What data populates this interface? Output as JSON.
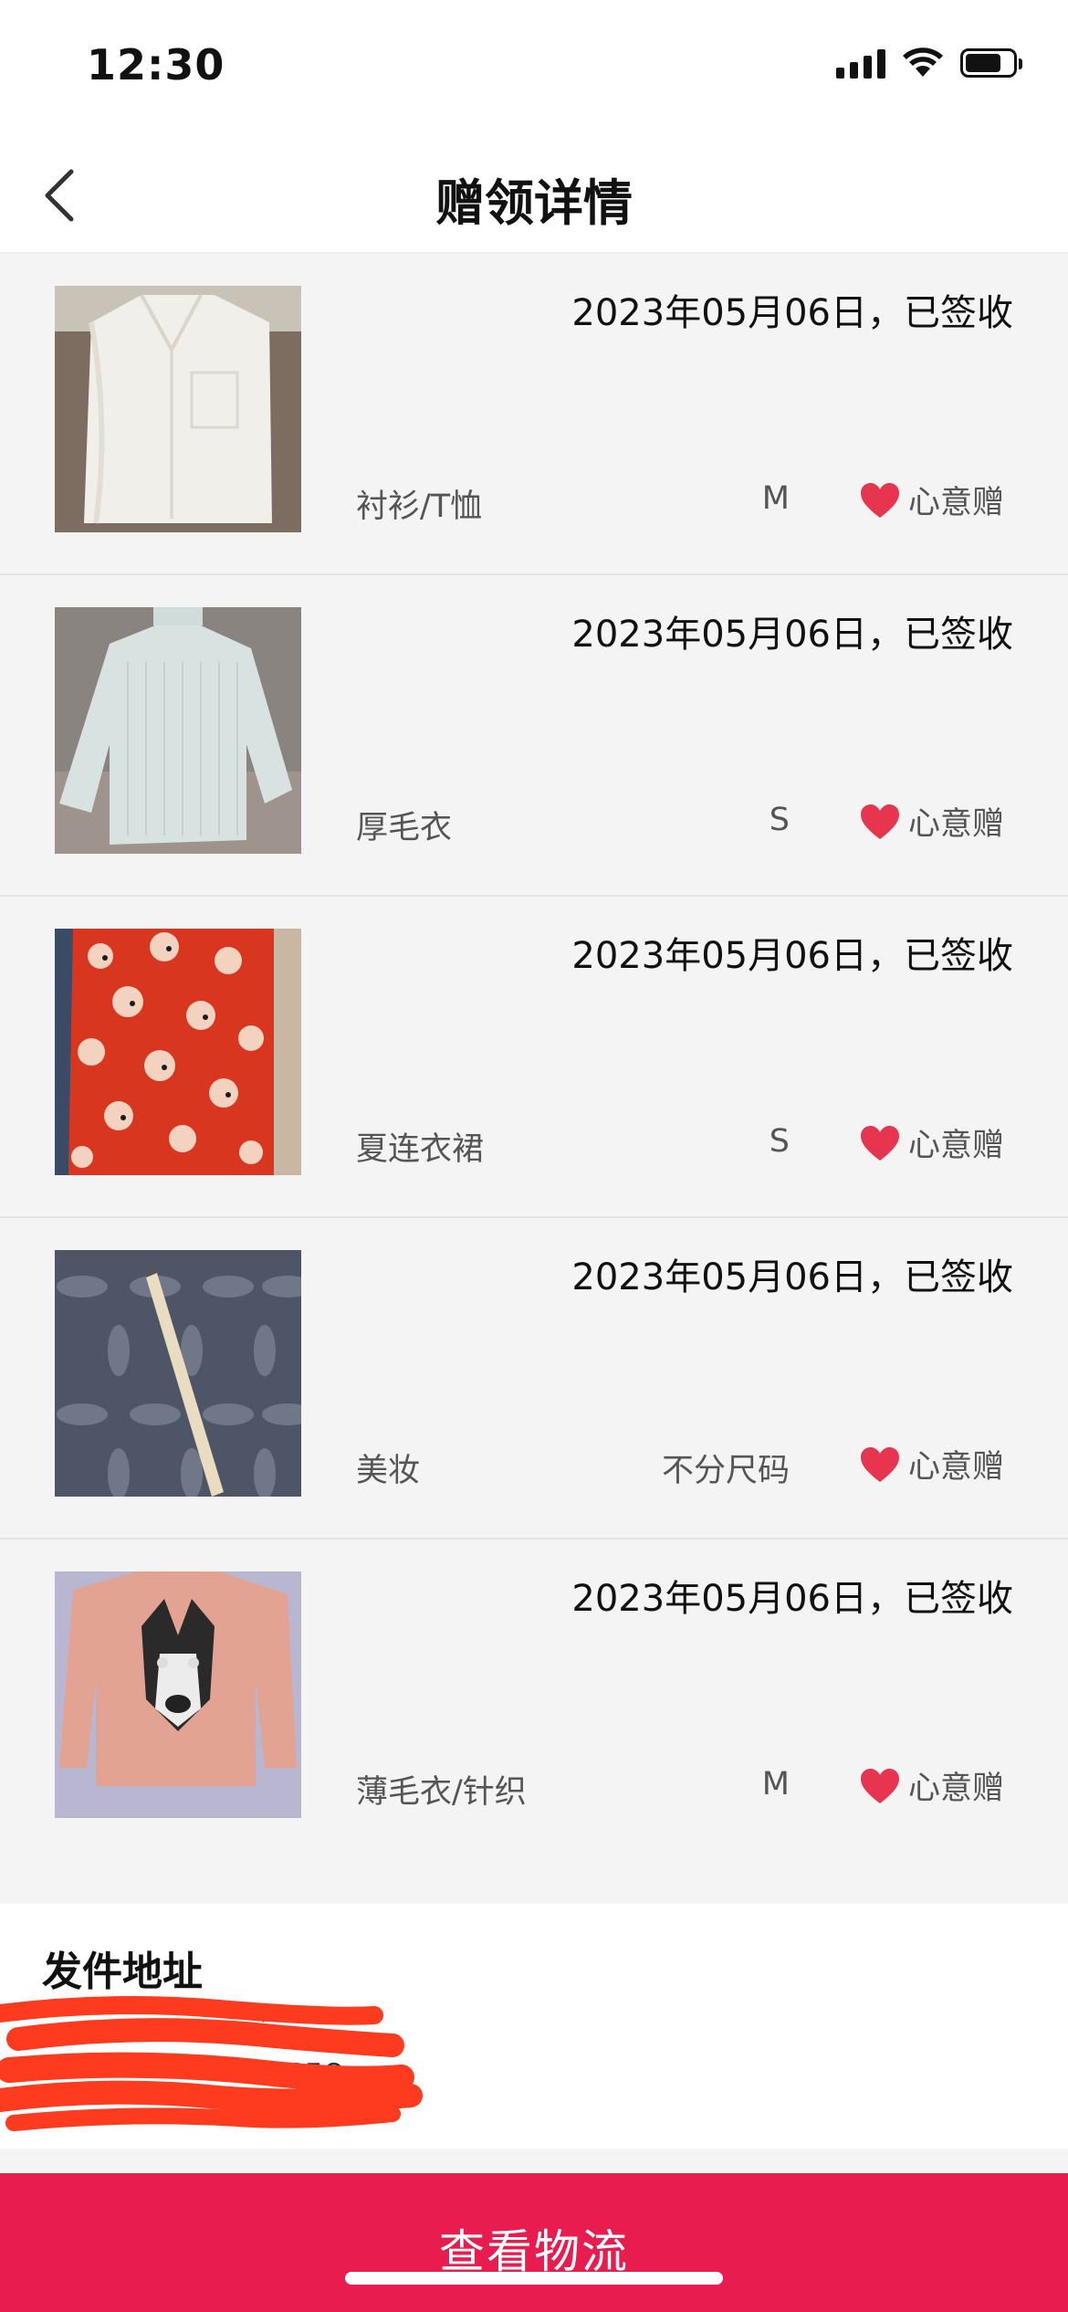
{
  "status_bar": {
    "time": "12:30"
  },
  "nav": {
    "title": "赠领详情",
    "back_icon": "chevron-left-icon"
  },
  "items": [
    {
      "name": "衬衫/T恤",
      "size": "M",
      "date_status": "2023年05月06日，已签收",
      "gift_type": "心意赠",
      "photo": "white-blouse"
    },
    {
      "name": "厚毛衣",
      "size": "S",
      "date_status": "2023年05月06日，已签收",
      "gift_type": "心意赠",
      "photo": "light-blue-sweater"
    },
    {
      "name": "夏连衣裙",
      "size": "S",
      "date_status": "2023年05月06日，已签收",
      "gift_type": "心意赠",
      "photo": "red-floral-dress"
    },
    {
      "name": "美妆",
      "size": "不分尺码",
      "date_status": "2023年05月06日，已签收",
      "gift_type": "心意赠",
      "photo": "makeup-pencil"
    },
    {
      "name": "薄毛衣/针织",
      "size": "M",
      "date_status": "2023年05月06日，已签收",
      "gift_type": "心意赠",
      "photo": "pink-dog-sweater"
    }
  ],
  "address": {
    "title": "发件地址",
    "line1": "*******",
    "line2": "7658"
  },
  "bottom": {
    "button_label": "查看物流"
  },
  "colors": {
    "accent": "#e81c4e",
    "heart": "#e8354f",
    "background": "#f4f4f4",
    "redaction": "#ff3b1f"
  }
}
